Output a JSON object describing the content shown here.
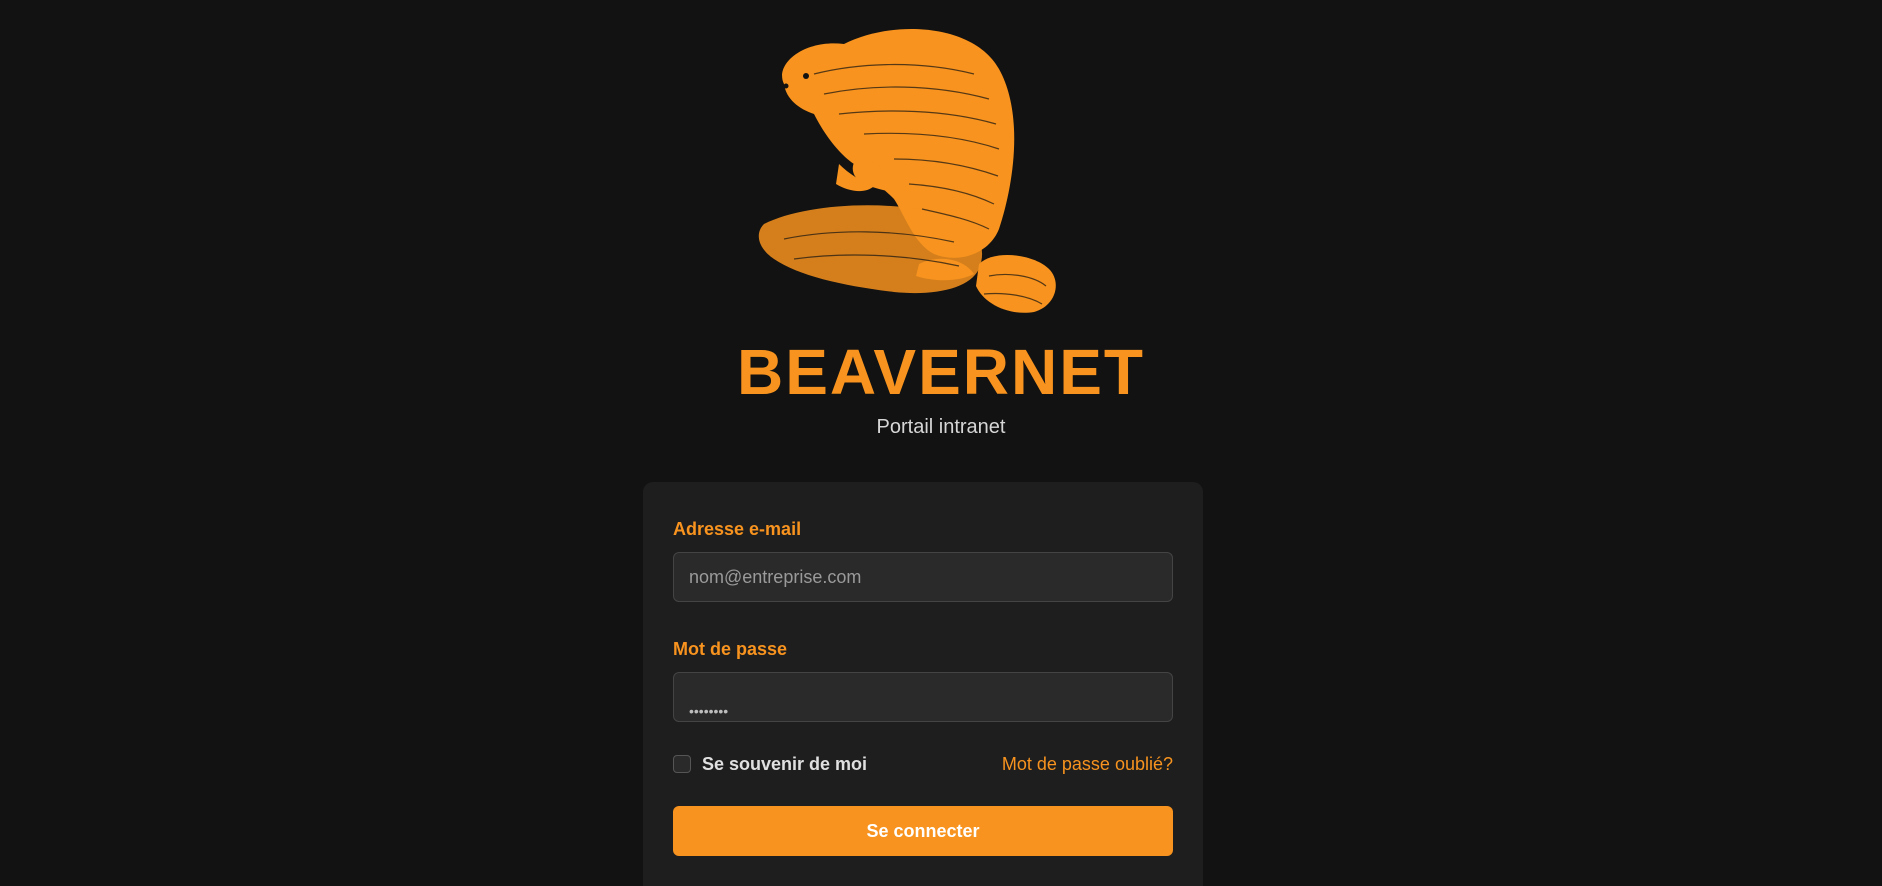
{
  "brand": {
    "title": "BEAVERNET",
    "subtitle": "Portail intranet",
    "logo_icon": "beaver-logo",
    "accent_color": "#f7931e"
  },
  "form": {
    "email": {
      "label": "Adresse e-mail",
      "value": "",
      "placeholder": "nom@entreprise.com"
    },
    "password": {
      "label": "Mot de passe",
      "value": "",
      "placeholder": "••••••••"
    },
    "remember": {
      "label": "Se souvenir de moi",
      "checked": false
    },
    "forgot_label": "Mot de passe oublié?",
    "submit_label": "Se connecter"
  }
}
